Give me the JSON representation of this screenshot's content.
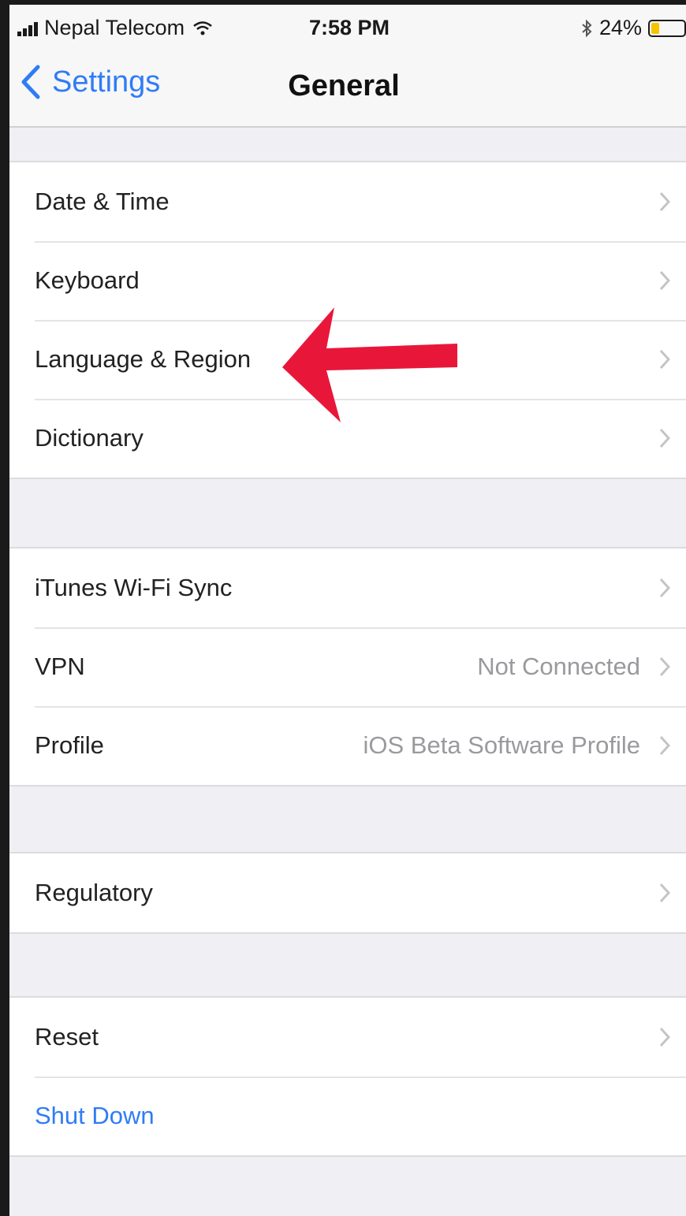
{
  "status_bar": {
    "carrier": "Nepal Telecom",
    "time": "7:58 PM",
    "battery": "24%",
    "battery_level": 0.24
  },
  "nav": {
    "back_label": "Settings",
    "title": "General"
  },
  "groups": [
    {
      "rows": [
        {
          "label": "Date & Time",
          "value": ""
        },
        {
          "label": "Keyboard",
          "value": ""
        },
        {
          "label": "Language & Region",
          "value": ""
        },
        {
          "label": "Dictionary",
          "value": ""
        }
      ]
    },
    {
      "rows": [
        {
          "label": "iTunes Wi-Fi Sync",
          "value": ""
        },
        {
          "label": "VPN",
          "value": "Not Connected"
        },
        {
          "label": "Profile",
          "value": "iOS Beta Software Profile"
        }
      ]
    },
    {
      "rows": [
        {
          "label": "Regulatory",
          "value": ""
        }
      ]
    },
    {
      "rows": [
        {
          "label": "Reset",
          "value": ""
        },
        {
          "label": "Shut Down",
          "value": ""
        }
      ]
    }
  ],
  "colors": {
    "accent": "#2f7cf6",
    "annotation_arrow": "#e8173a",
    "battery": "#f5c400"
  },
  "icons": [
    "signal-icon",
    "wifi-icon",
    "bluetooth-icon",
    "battery-icon",
    "back-chevron-icon",
    "chevron-right-icon",
    "red-arrow-annotation"
  ]
}
